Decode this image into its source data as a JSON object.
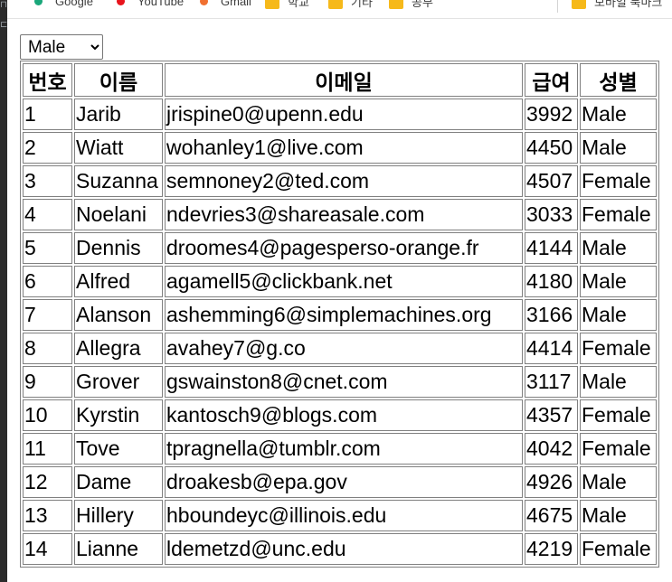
{
  "bookmarks": [
    {
      "label": "Google",
      "icon": "google-dot-icon",
      "color": "#1aa77a"
    },
    {
      "label": "YouTube",
      "icon": "youtube-dot-icon",
      "color": "#e8141c"
    },
    {
      "label": "Gmail",
      "icon": "gmail-dot-icon",
      "color": "#f07030"
    },
    {
      "label": "학교",
      "icon": "folder-icon",
      "color": "#f6b91a"
    },
    {
      "label": "기타",
      "icon": "folder-icon",
      "color": "#f6b91a"
    },
    {
      "label": "공부",
      "icon": "folder-icon",
      "color": "#f6b91a"
    },
    {
      "label": "모바일 북마크",
      "icon": "folder-icon",
      "color": "#f6b91a"
    }
  ],
  "filter": {
    "selected": "Male",
    "options": [
      "Male"
    ]
  },
  "table": {
    "headers": [
      "번호",
      "이름",
      "이메일",
      "급여",
      "성별"
    ],
    "rows": [
      [
        "1",
        "Jarib",
        "jrispine0@upenn.edu",
        "3992",
        "Male"
      ],
      [
        "2",
        "Wiatt",
        "wohanley1@live.com",
        "4450",
        "Male"
      ],
      [
        "3",
        "Suzanna",
        "semnoney2@ted.com",
        "4507",
        "Female"
      ],
      [
        "4",
        "Noelani",
        "ndevries3@shareasale.com",
        "3033",
        "Female"
      ],
      [
        "5",
        "Dennis",
        "droomes4@pagesperso-orange.fr",
        "4144",
        "Male"
      ],
      [
        "6",
        "Alfred",
        "agamell5@clickbank.net",
        "4180",
        "Male"
      ],
      [
        "7",
        "Alanson",
        "ashemming6@simplemachines.org",
        "3166",
        "Male"
      ],
      [
        "8",
        "Allegra",
        "avahey7@g.co",
        "4414",
        "Female"
      ],
      [
        "9",
        "Grover",
        "gswainston8@cnet.com",
        "3117",
        "Male"
      ],
      [
        "10",
        "Kyrstin",
        "kantosch9@blogs.com",
        "4357",
        "Female"
      ],
      [
        "11",
        "Tove",
        "tpragnella@tumblr.com",
        "4042",
        "Female"
      ],
      [
        "12",
        "Dame",
        "droakesb@epa.gov",
        "4926",
        "Male"
      ],
      [
        "13",
        "Hillery",
        "hboundeyc@illinois.edu",
        "4675",
        "Male"
      ],
      [
        "14",
        "Lianne",
        "ldemetzd@unc.edu",
        "4219",
        "Female"
      ]
    ]
  }
}
